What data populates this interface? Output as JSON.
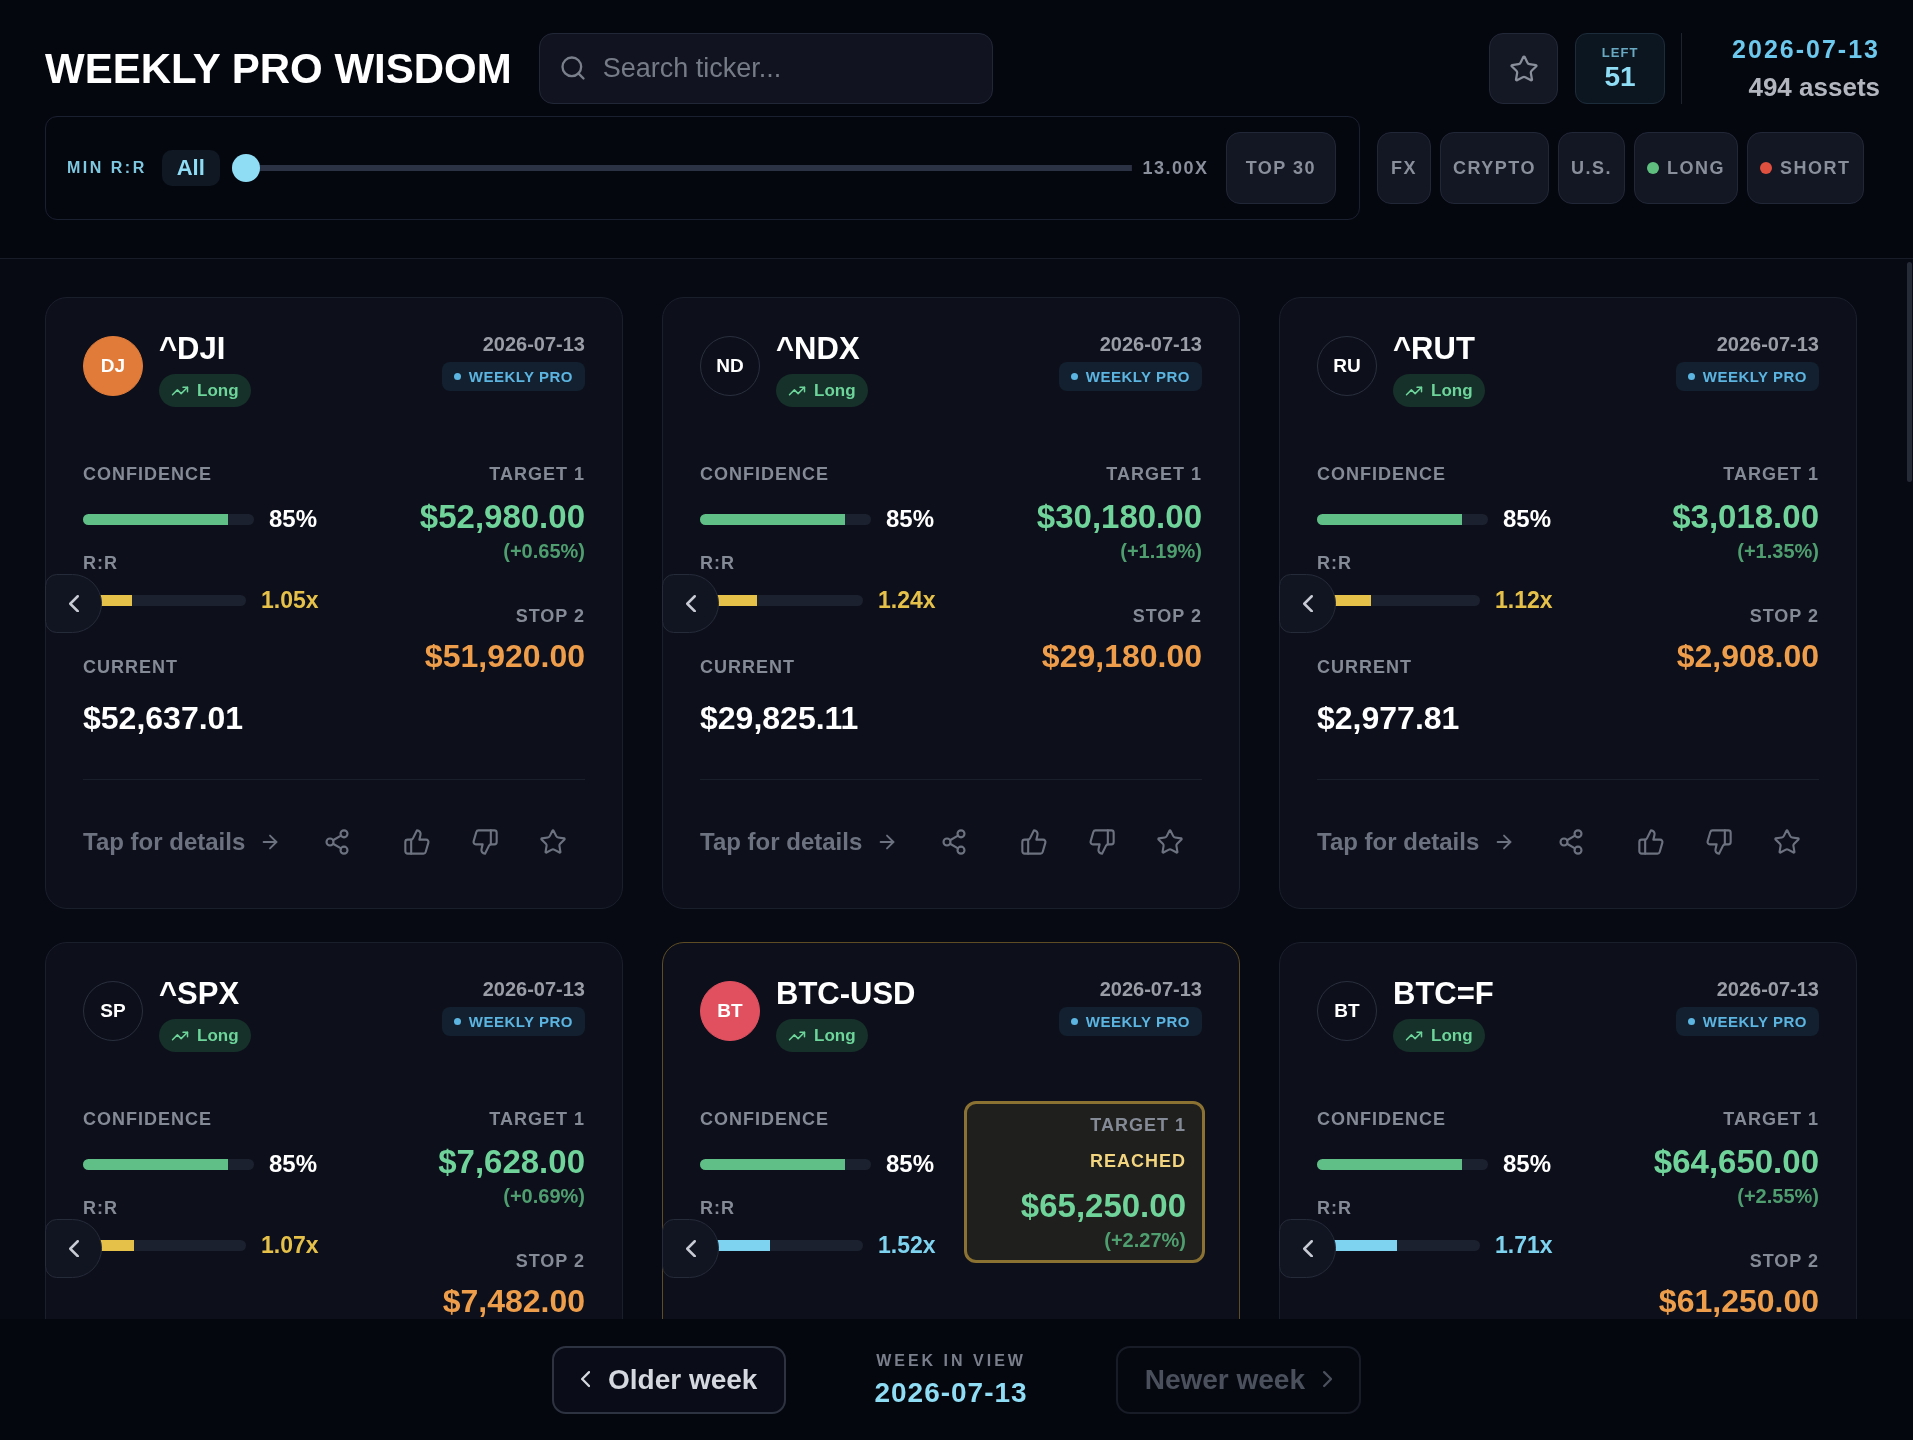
{
  "header": {
    "title": "WEEKLY PRO WISDOM",
    "search": {
      "placeholder": "Search ticker..."
    },
    "favorites": {
      "selected": false
    },
    "counter": {
      "label": "LEFT",
      "value": "51"
    },
    "date": "2026-07-13",
    "assets": "494 assets"
  },
  "filters": {
    "min_rr": {
      "label": "MIN R:R",
      "value": "All",
      "level": 0,
      "max": "13.00X"
    },
    "top": {
      "label": "TOP 30",
      "selected": false
    },
    "chips": [
      {
        "label": "FX",
        "selected": false
      },
      {
        "label": "CRYPTO",
        "selected": false
      },
      {
        "label": "U.S.",
        "selected": false
      },
      {
        "label": "LONG",
        "selected": false,
        "color": "#5fbf7f"
      },
      {
        "label": "SHORT",
        "selected": false,
        "color": "#e0503f"
      }
    ]
  },
  "cards": [
    {
      "avatar": {
        "initials": "DJ",
        "color": "#e07b39"
      },
      "ticker": "^DJI",
      "direction": {
        "label": "Long",
        "kind": "long"
      },
      "date": "2026-07-13",
      "badge": "WEEKLY PRO",
      "confidence": {
        "label": "CONFIDENCE",
        "value": "85%",
        "level": 0.85
      },
      "rr": {
        "label": "R:R",
        "value": "1.05x",
        "level": 0.3,
        "color": "#e6c14a"
      },
      "current": {
        "label": "CURRENT",
        "value": "$52,637.01"
      },
      "target": {
        "label": "TARGET 1",
        "value": "$52,980.00",
        "change": "(+0.65%)",
        "reached": false
      },
      "stop": {
        "label": "STOP 2",
        "value": "$51,920.00"
      },
      "details": "Tap for details",
      "liked": false,
      "disliked": false,
      "starred": false
    },
    {
      "avatar": {
        "initials": "ND"
      },
      "ticker": "^NDX",
      "direction": {
        "label": "Long",
        "kind": "long"
      },
      "date": "2026-07-13",
      "badge": "WEEKLY PRO",
      "confidence": {
        "label": "CONFIDENCE",
        "value": "85%",
        "level": 0.85
      },
      "rr": {
        "label": "R:R",
        "value": "1.24x",
        "level": 0.35,
        "color": "#e6c14a"
      },
      "current": {
        "label": "CURRENT",
        "value": "$29,825.11"
      },
      "target": {
        "label": "TARGET 1",
        "value": "$30,180.00",
        "change": "(+1.19%)",
        "reached": false
      },
      "stop": {
        "label": "STOP 2",
        "value": "$29,180.00"
      },
      "details": "Tap for details",
      "liked": false,
      "disliked": false,
      "starred": false
    },
    {
      "avatar": {
        "initials": "RU"
      },
      "ticker": "^RUT",
      "direction": {
        "label": "Long",
        "kind": "long"
      },
      "date": "2026-07-13",
      "badge": "WEEKLY PRO",
      "confidence": {
        "label": "CONFIDENCE",
        "value": "85%",
        "level": 0.85
      },
      "rr": {
        "label": "R:R",
        "value": "1.12x",
        "level": 0.33,
        "color": "#e6c14a"
      },
      "current": {
        "label": "CURRENT",
        "value": "$2,977.81"
      },
      "target": {
        "label": "TARGET 1",
        "value": "$3,018.00",
        "change": "(+1.35%)",
        "reached": false
      },
      "stop": {
        "label": "STOP 2",
        "value": "$2,908.00"
      },
      "details": "Tap for details",
      "liked": false,
      "disliked": false,
      "starred": false
    },
    {
      "avatar": {
        "initials": "SP"
      },
      "ticker": "^SPX",
      "direction": {
        "label": "Long",
        "kind": "long"
      },
      "date": "2026-07-13",
      "badge": "WEEKLY PRO",
      "confidence": {
        "label": "CONFIDENCE",
        "value": "85%",
        "level": 0.85
      },
      "rr": {
        "label": "R:R",
        "value": "1.07x",
        "level": 0.31,
        "color": "#e6c14a"
      },
      "target": {
        "label": "TARGET 1",
        "value": "$7,628.00",
        "change": "(+0.69%)",
        "reached": false
      },
      "stop": {
        "label": "STOP 2",
        "value": "$7,482.00"
      }
    },
    {
      "avatar": {
        "initials": "BT",
        "color": "#e0505f"
      },
      "ticker": "BTC-USD",
      "direction": {
        "label": "Long",
        "kind": "long"
      },
      "date": "2026-07-13",
      "badge": "WEEKLY PRO",
      "confidence": {
        "label": "CONFIDENCE",
        "value": "85%",
        "level": 0.85
      },
      "rr": {
        "label": "R:R",
        "value": "1.52x",
        "level": 0.43,
        "color": "#7dd3f0"
      },
      "target": {
        "label": "TARGET 1",
        "value": "$65,250.00",
        "change": "(+2.27%)",
        "reached": true,
        "reached_label": "REACHED"
      }
    },
    {
      "avatar": {
        "initials": "BT"
      },
      "ticker": "BTC=F",
      "direction": {
        "label": "Long",
        "kind": "long"
      },
      "date": "2026-07-13",
      "badge": "WEEKLY PRO",
      "confidence": {
        "label": "CONFIDENCE",
        "value": "85%",
        "level": 0.85
      },
      "rr": {
        "label": "R:R",
        "value": "1.71x",
        "level": 0.49,
        "color": "#7dd3f0"
      },
      "target": {
        "label": "TARGET 1",
        "value": "$64,650.00",
        "change": "(+2.55%)",
        "reached": false
      },
      "stop": {
        "label": "STOP 2",
        "value": "$61,250.00"
      }
    }
  ],
  "footer": {
    "older": {
      "label": "Older week",
      "disabled": false
    },
    "week": {
      "label": "WEEK IN VIEW",
      "value": "2026-07-13"
    },
    "newer": {
      "label": "Newer week",
      "disabled": true
    }
  }
}
